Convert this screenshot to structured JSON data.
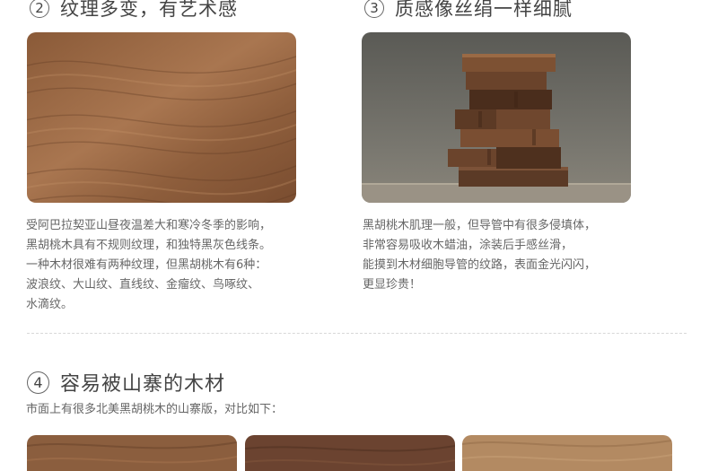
{
  "section2": {
    "number": "2",
    "title": "纹理多变，有艺术感",
    "desc_lines": [
      "受阿巴拉契亚山昼夜温差大和寒冷冬季的影响，",
      "黑胡桃木具有不规则纹理，和独特黑灰色线条。",
      "一种木材很难有两种纹理，但黑胡桃木有6种：",
      "波浪纹、大山纹、直线纹、金瘤纹、鸟啄纹、",
      "水滴纹。"
    ]
  },
  "section3": {
    "number": "3",
    "title": "质感像丝绢一样细腻",
    "desc_lines": [
      "黑胡桃木肌理一般，但导管中有很多侵填体，",
      "非常容易吸收木蜡油，涂装后手感丝滑，",
      "能摸到木材细胞导管的纹路，表面金光闪闪，",
      "更显珍贵！"
    ]
  },
  "section4": {
    "number": "4",
    "title": "容易被山寨的木材",
    "subtitle": "市面上有很多北美黑胡桃木的山寨版，对比如下："
  },
  "colors": {
    "wood_light": "#9a6a45",
    "wood_dark": "#5a3826",
    "wood_sample3": "#b98f68"
  }
}
